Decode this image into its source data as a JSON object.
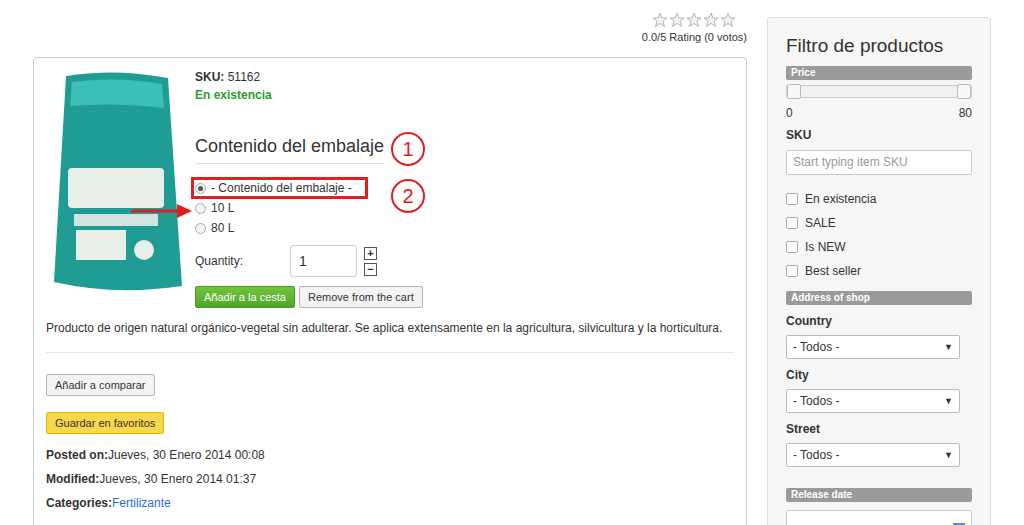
{
  "rating": {
    "stars": 0,
    "total": 5,
    "text": "0.0/5 Rating (0 votos)"
  },
  "product": {
    "sku_label": "SKU:",
    "sku": "51162",
    "stock": "En existencia",
    "option_title": "Contenido del embalaje",
    "options": [
      {
        "label": "- Contenido del embalaje -",
        "selected": true,
        "highlighted": true
      },
      {
        "label": "10 L",
        "selected": false,
        "highlighted": false
      },
      {
        "label": "80 L",
        "selected": false,
        "highlighted": false
      }
    ],
    "quantity_label": "Quantity:",
    "quantity": "1",
    "plus": "+",
    "minus": "−",
    "add_button": "Añadir a la cesta",
    "remove_button": "Remove from the cart",
    "description": "Producto de origen natural orgánico-vegetal sin adulterar. Se aplica extensamente en la agricultura,  silvicultura y la horticultura.",
    "compare_button": "Añadir a comparar",
    "favorite_button": "Guardar en favoritos",
    "meta": [
      {
        "label": "Posted on:",
        "value": "Jueves, 30 Enero 2014 00:08",
        "kind": "text"
      },
      {
        "label": "Modified:",
        "value": "Jueves, 30 Enero 2014 01:37",
        "kind": "text"
      },
      {
        "label": "Categories:",
        "value": "Fertilizante",
        "kind": "link"
      }
    ]
  },
  "annotations": {
    "title_marker": "1",
    "option_marker": "2"
  },
  "sidebar": {
    "title": "Filtro de productos",
    "price": {
      "header": "Price",
      "low_level": 0,
      "high_level": 1,
      "min": "0",
      "max": "80"
    },
    "sku": {
      "label": "SKU",
      "placeholder": "Start typing item SKU"
    },
    "checkboxes": [
      {
        "label": "En existencia",
        "checked": false
      },
      {
        "label": "SALE",
        "checked": false
      },
      {
        "label": "Is NEW",
        "checked": false
      },
      {
        "label": "Best seller",
        "checked": false
      }
    ],
    "address_header": "Address of shop",
    "select_arrow": "▼",
    "selects": [
      {
        "label": "Country",
        "value": "- Todos -"
      },
      {
        "label": "City",
        "value": "- Todos -"
      },
      {
        "label": "Street",
        "value": "- Todos -"
      }
    ],
    "release_header": "Release date"
  }
}
